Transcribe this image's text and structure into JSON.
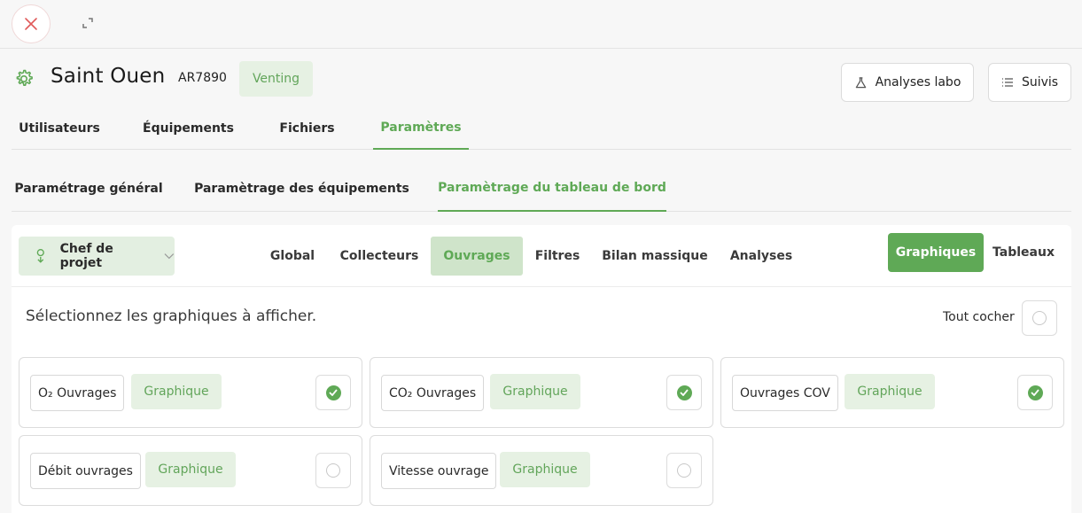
{
  "header": {
    "title": "Saint Ouen",
    "code": "AR7890",
    "badge": "Venting",
    "buttons": {
      "labo": "Analyses labo",
      "suivis": "Suivis"
    }
  },
  "main_tabs": [
    {
      "label": "Utilisateurs",
      "active": false
    },
    {
      "label": "Équipements",
      "active": false
    },
    {
      "label": "Fichiers",
      "active": false
    },
    {
      "label": "Paramètres",
      "active": true
    }
  ],
  "settings_tabs": [
    {
      "label": "Paramétrage général",
      "active": false
    },
    {
      "label": "Paramètrage des équipements",
      "active": false
    },
    {
      "label": "Paramètrage du tableau de bord",
      "active": true
    }
  ],
  "toolbar": {
    "role": "Chef de projet",
    "sub_tabs": [
      {
        "label": "Global",
        "active": false
      },
      {
        "label": "Collecteurs",
        "active": false
      },
      {
        "label": "Ouvrages",
        "active": true
      },
      {
        "label": "Filtres",
        "active": false
      },
      {
        "label": "Bilan massique",
        "active": false
      },
      {
        "label": "Analyses",
        "active": false
      }
    ],
    "views": {
      "graphiques": "Graphiques",
      "tableaux": "Tableaux",
      "active": "graphiques"
    }
  },
  "selection": {
    "prompt": "Sélectionnez les graphiques à afficher.",
    "check_all_label": "Tout cocher",
    "check_all_checked": false
  },
  "cards": [
    {
      "label": "O₂ Ouvrages",
      "type": "Graphique",
      "checked": true
    },
    {
      "label": "CO₂ Ouvrages",
      "type": "Graphique",
      "checked": true
    },
    {
      "label": "Ouvrages COV",
      "type": "Graphique",
      "checked": true
    },
    {
      "label": "Débit ouvrages",
      "type": "Graphique",
      "checked": false
    },
    {
      "label": "Vitesse ouvrage",
      "type": "Graphique",
      "checked": false
    }
  ],
  "colors": {
    "accent": "#5fa956",
    "accent_light": "#e6f1e3",
    "close": "#e05a5a"
  },
  "icons": {
    "close": "close-icon",
    "expand": "expand-icon",
    "gear": "gear-icon",
    "flask": "flask-icon",
    "list": "list-icon",
    "user": "user-icon",
    "chevron": "chevron-down-icon",
    "check": "check-icon"
  }
}
